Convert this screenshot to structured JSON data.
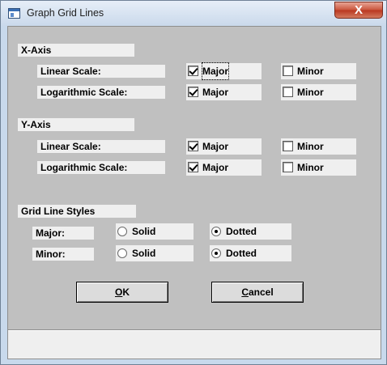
{
  "window": {
    "title": "Graph Grid Lines",
    "close_glyph": "X",
    "icon": "app-window-icon"
  },
  "x_axis": {
    "heading": "X-Axis",
    "rows": [
      {
        "label": "Linear Scale:",
        "major": {
          "label": "Major",
          "checked": true
        },
        "minor": {
          "label": "Minor",
          "checked": false
        }
      },
      {
        "label": "Logarithmic Scale:",
        "major": {
          "label": "Major",
          "checked": true
        },
        "minor": {
          "label": "Minor",
          "checked": false
        }
      }
    ]
  },
  "y_axis": {
    "heading": "Y-Axis",
    "rows": [
      {
        "label": "Linear Scale:",
        "major": {
          "label": "Major",
          "checked": true
        },
        "minor": {
          "label": "Minor",
          "checked": false
        }
      },
      {
        "label": "Logarithmic Scale:",
        "major": {
          "label": "Major",
          "checked": true
        },
        "minor": {
          "label": "Minor",
          "checked": false
        }
      }
    ]
  },
  "grid_line_styles": {
    "heading": "Grid Line Styles",
    "rows": [
      {
        "label": "Major:",
        "solid": {
          "label": "Solid",
          "selected": false
        },
        "dotted": {
          "label": "Dotted",
          "selected": true
        }
      },
      {
        "label": "Minor:",
        "solid": {
          "label": "Solid",
          "selected": false
        },
        "dotted": {
          "label": "Dotted",
          "selected": true
        }
      }
    ]
  },
  "buttons": {
    "ok_mnemonic": "O",
    "ok_rest": "K",
    "cancel_mnemonic": "C",
    "cancel_rest": "ancel"
  },
  "status_bar": {
    "text": ""
  }
}
